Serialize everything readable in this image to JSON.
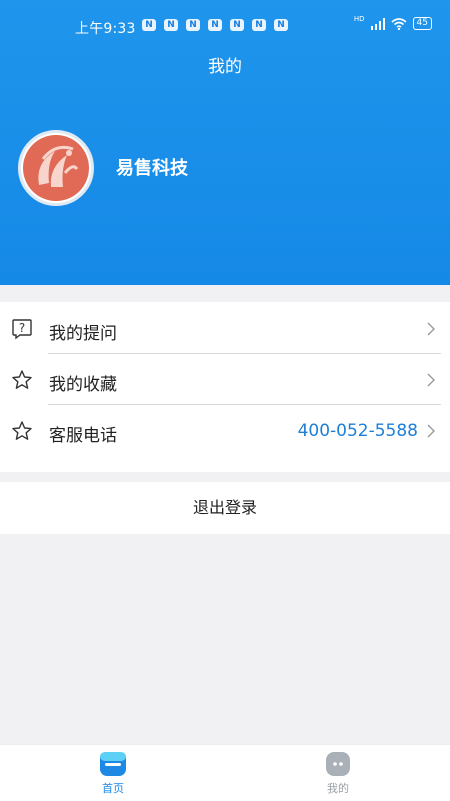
{
  "status_bar": {
    "time": "上午9:33",
    "notification_badges": [
      "N",
      "N",
      "N",
      "N",
      "N",
      "N",
      "N"
    ],
    "network": "HD",
    "battery": "45"
  },
  "header": {
    "title": "我的",
    "username": "易售科技"
  },
  "menu": {
    "items": [
      {
        "label": "我的提问",
        "icon": "question-icon"
      },
      {
        "label": "我的收藏",
        "icon": "star-icon"
      },
      {
        "label": "客服电话",
        "icon": "star-icon",
        "value": "400-052-5588"
      }
    ]
  },
  "logout": {
    "label": "退出登录"
  },
  "tabbar": {
    "tabs": [
      {
        "label": "首页",
        "active": true
      },
      {
        "label": "我的",
        "active": false
      }
    ]
  },
  "colors": {
    "header_blue": "#1589e6",
    "phone_blue": "#1e7fd6",
    "tab_active": "#1e88e5",
    "tab_inactive": "#9aa0a6"
  }
}
